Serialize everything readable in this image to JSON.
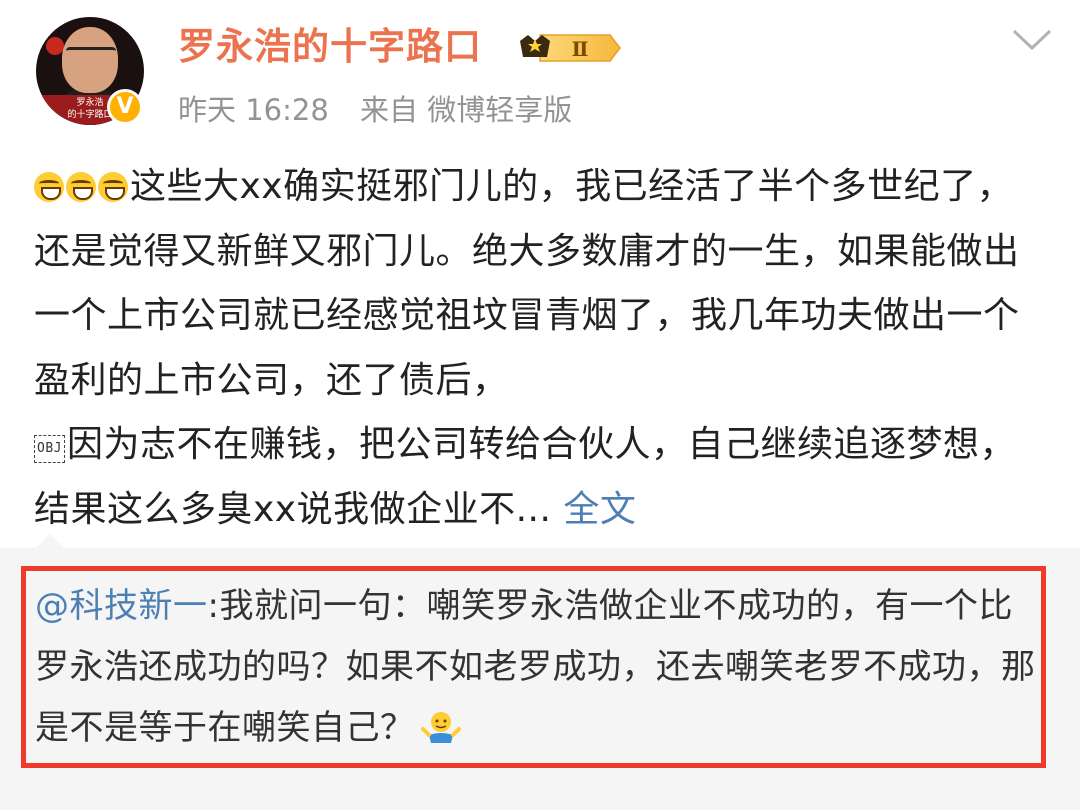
{
  "author": {
    "name": "罗永浩的十字路口",
    "vip_badge_text": "Ⅱ",
    "verified_mark": "V",
    "avatar_caption_line1": "罗永浩",
    "avatar_caption_line2": "的十字路口"
  },
  "meta": {
    "time": "昨天 16:28",
    "source": "来自 微博轻享版"
  },
  "post": {
    "emoji_name": "laugh-emoji",
    "obj_placeholder": "OBJ",
    "text_part1": "这些大xx确实挺邪门儿的，我已经活了半个多世纪了，还是觉得又新鲜又邪门儿。绝大多数庸才的一生，如果能做出一个上市公司就已经感觉祖坟冒青烟了，我几年功夫做出一个盈利的上市公司，还了债后，",
    "text_part2": "因为志不在赚钱，把公司转给合伙人，自己继续追逐梦想，结果这么多臭xx说我做企业不... ",
    "full_text_link": "全文"
  },
  "retweet": {
    "mention": "@科技新一",
    "text": ":我就问一句：嘲笑罗永浩做企业不成功的，有一个比罗永浩还成功的吗？如果不如老罗成功，还去嘲笑老罗不成功，那是不是等于在嘲笑自己？",
    "emoji_name": "shrug-emoji"
  },
  "colors": {
    "author_name": "#eb7350",
    "link": "#4c7fb3",
    "meta": "#939393",
    "highlight_border": "#f03a2e",
    "retweet_bg": "#f5f5f5"
  }
}
